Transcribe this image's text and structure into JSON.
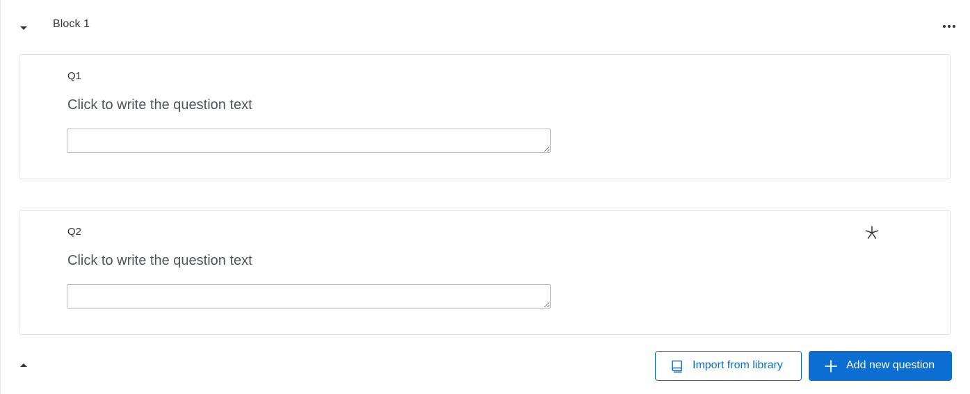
{
  "block": {
    "title": "Block 1",
    "collapse_icon": "caret-down-icon",
    "menu_icon": "more-horizontal-icon",
    "bottom_collapse_icon": "caret-up-icon"
  },
  "questions": [
    {
      "number": "Q1",
      "text": "Click to write the question text",
      "answer_value": "",
      "required": false
    },
    {
      "number": "Q2",
      "text": "Click to write the question text",
      "answer_value": "",
      "required": true,
      "required_icon": "asterisk-icon"
    }
  ],
  "actions": {
    "import_label": "Import from library",
    "import_icon": "book-icon",
    "add_label": "Add new question",
    "add_icon": "plus-icon"
  },
  "colors": {
    "accent": "#0b6ed0",
    "text": "#32363a",
    "border": "#dfe2e6"
  }
}
